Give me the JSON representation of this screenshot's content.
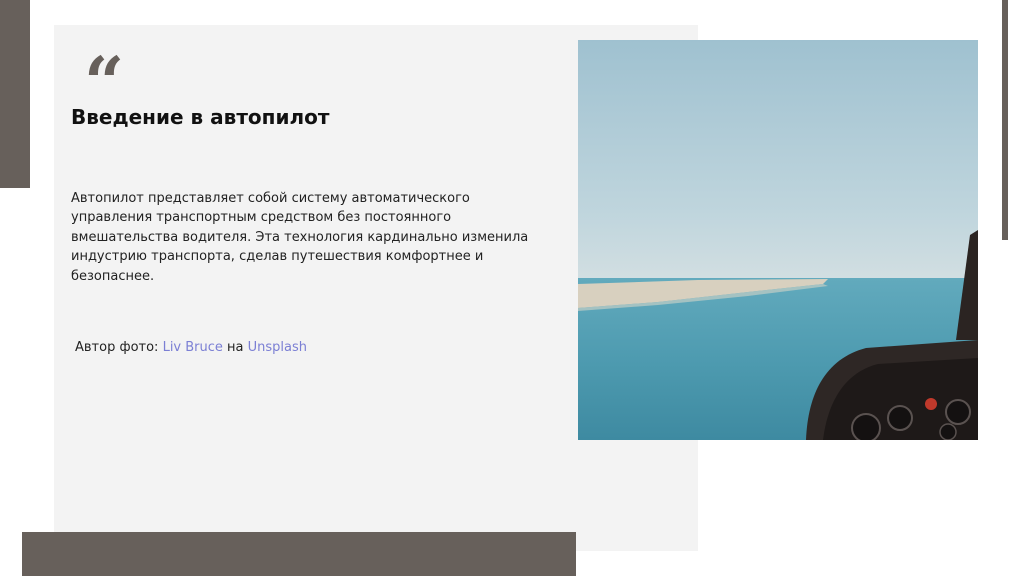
{
  "slide": {
    "quote_mark": "“",
    "title": "Введение в автопилот",
    "body": "Автопилот представляет собой систему автоматического управления транспортным средством без постоянного вмешательства водителя. Эта технология кардинально изменила индустрию транспорта, сделав путешествия комфортнее и безопаснее.",
    "credit": {
      "prefix": "Автор фото: ",
      "author": "Liv Bruce",
      "middle": " на ",
      "source": "Unsplash"
    }
  },
  "colors": {
    "accent": "#67605b",
    "card": "#f3f3f3",
    "link": "#7b7fd4",
    "sky": "#a9c7d3",
    "sea": "#4f9cb0"
  }
}
